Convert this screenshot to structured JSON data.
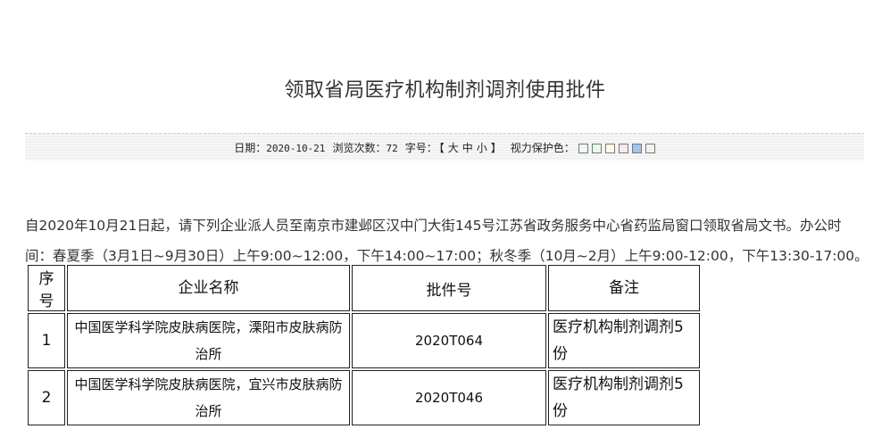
{
  "article": {
    "title": "领取省局医疗机构制剂调剂使用批件"
  },
  "meta": {
    "date_label": "日期：",
    "date_value": "2020-10-21",
    "views_label": "浏览次数：",
    "views_value": "72",
    "font_label": "字号：",
    "font_open": "【",
    "font_large": "大",
    "font_medium": "中",
    "font_small": "小",
    "font_close": "】",
    "eye_label": "视力保护色：",
    "swatches": [
      "#eef6fb",
      "#e8f7ec",
      "#fdfbe0",
      "#fbe8ee",
      "#9fc4ef",
      "#f2f2f2"
    ]
  },
  "notice": {
    "text": "自2020年10月21日起，请下列企业派人员至南京市建邺区汉中门大街145号江苏省政务服务中心省药监局窗口领取省局文书。办公时间：春夏季（3月1日~9月30日）上午9:00~12:00，下午14:00~17:00；秋冬季（10月~2月）上午9:00-12:00，下午13:30-17:00。"
  },
  "table": {
    "headers": [
      "序号",
      "企业名称",
      "批件号",
      "备注"
    ],
    "rows": [
      {
        "index": "1",
        "company": "中国医学科学院皮肤病医院，溧阳市皮肤病防治所",
        "approval_no": "2020T064",
        "note": "医疗机构制剂调剂5份"
      },
      {
        "index": "2",
        "company": "中国医学科学院皮肤病医院，宜兴市皮肤病防治所",
        "approval_no": "2020T046",
        "note": "医疗机构制剂调剂5份"
      }
    ]
  }
}
